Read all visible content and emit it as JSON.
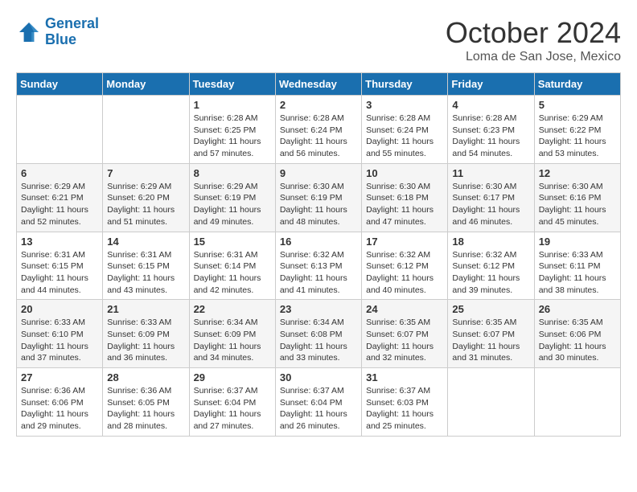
{
  "logo": {
    "line1": "General",
    "line2": "Blue"
  },
  "title": "October 2024",
  "location": "Loma de San Jose, Mexico",
  "weekdays": [
    "Sunday",
    "Monday",
    "Tuesday",
    "Wednesday",
    "Thursday",
    "Friday",
    "Saturday"
  ],
  "weeks": [
    [
      {
        "day": "",
        "info": ""
      },
      {
        "day": "",
        "info": ""
      },
      {
        "day": "1",
        "info": "Sunrise: 6:28 AM\nSunset: 6:25 PM\nDaylight: 11 hours and 57 minutes."
      },
      {
        "day": "2",
        "info": "Sunrise: 6:28 AM\nSunset: 6:24 PM\nDaylight: 11 hours and 56 minutes."
      },
      {
        "day": "3",
        "info": "Sunrise: 6:28 AM\nSunset: 6:24 PM\nDaylight: 11 hours and 55 minutes."
      },
      {
        "day": "4",
        "info": "Sunrise: 6:28 AM\nSunset: 6:23 PM\nDaylight: 11 hours and 54 minutes."
      },
      {
        "day": "5",
        "info": "Sunrise: 6:29 AM\nSunset: 6:22 PM\nDaylight: 11 hours and 53 minutes."
      }
    ],
    [
      {
        "day": "6",
        "info": "Sunrise: 6:29 AM\nSunset: 6:21 PM\nDaylight: 11 hours and 52 minutes."
      },
      {
        "day": "7",
        "info": "Sunrise: 6:29 AM\nSunset: 6:20 PM\nDaylight: 11 hours and 51 minutes."
      },
      {
        "day": "8",
        "info": "Sunrise: 6:29 AM\nSunset: 6:19 PM\nDaylight: 11 hours and 49 minutes."
      },
      {
        "day": "9",
        "info": "Sunrise: 6:30 AM\nSunset: 6:19 PM\nDaylight: 11 hours and 48 minutes."
      },
      {
        "day": "10",
        "info": "Sunrise: 6:30 AM\nSunset: 6:18 PM\nDaylight: 11 hours and 47 minutes."
      },
      {
        "day": "11",
        "info": "Sunrise: 6:30 AM\nSunset: 6:17 PM\nDaylight: 11 hours and 46 minutes."
      },
      {
        "day": "12",
        "info": "Sunrise: 6:30 AM\nSunset: 6:16 PM\nDaylight: 11 hours and 45 minutes."
      }
    ],
    [
      {
        "day": "13",
        "info": "Sunrise: 6:31 AM\nSunset: 6:15 PM\nDaylight: 11 hours and 44 minutes."
      },
      {
        "day": "14",
        "info": "Sunrise: 6:31 AM\nSunset: 6:15 PM\nDaylight: 11 hours and 43 minutes."
      },
      {
        "day": "15",
        "info": "Sunrise: 6:31 AM\nSunset: 6:14 PM\nDaylight: 11 hours and 42 minutes."
      },
      {
        "day": "16",
        "info": "Sunrise: 6:32 AM\nSunset: 6:13 PM\nDaylight: 11 hours and 41 minutes."
      },
      {
        "day": "17",
        "info": "Sunrise: 6:32 AM\nSunset: 6:12 PM\nDaylight: 11 hours and 40 minutes."
      },
      {
        "day": "18",
        "info": "Sunrise: 6:32 AM\nSunset: 6:12 PM\nDaylight: 11 hours and 39 minutes."
      },
      {
        "day": "19",
        "info": "Sunrise: 6:33 AM\nSunset: 6:11 PM\nDaylight: 11 hours and 38 minutes."
      }
    ],
    [
      {
        "day": "20",
        "info": "Sunrise: 6:33 AM\nSunset: 6:10 PM\nDaylight: 11 hours and 37 minutes."
      },
      {
        "day": "21",
        "info": "Sunrise: 6:33 AM\nSunset: 6:09 PM\nDaylight: 11 hours and 36 minutes."
      },
      {
        "day": "22",
        "info": "Sunrise: 6:34 AM\nSunset: 6:09 PM\nDaylight: 11 hours and 34 minutes."
      },
      {
        "day": "23",
        "info": "Sunrise: 6:34 AM\nSunset: 6:08 PM\nDaylight: 11 hours and 33 minutes."
      },
      {
        "day": "24",
        "info": "Sunrise: 6:35 AM\nSunset: 6:07 PM\nDaylight: 11 hours and 32 minutes."
      },
      {
        "day": "25",
        "info": "Sunrise: 6:35 AM\nSunset: 6:07 PM\nDaylight: 11 hours and 31 minutes."
      },
      {
        "day": "26",
        "info": "Sunrise: 6:35 AM\nSunset: 6:06 PM\nDaylight: 11 hours and 30 minutes."
      }
    ],
    [
      {
        "day": "27",
        "info": "Sunrise: 6:36 AM\nSunset: 6:06 PM\nDaylight: 11 hours and 29 minutes."
      },
      {
        "day": "28",
        "info": "Sunrise: 6:36 AM\nSunset: 6:05 PM\nDaylight: 11 hours and 28 minutes."
      },
      {
        "day": "29",
        "info": "Sunrise: 6:37 AM\nSunset: 6:04 PM\nDaylight: 11 hours and 27 minutes."
      },
      {
        "day": "30",
        "info": "Sunrise: 6:37 AM\nSunset: 6:04 PM\nDaylight: 11 hours and 26 minutes."
      },
      {
        "day": "31",
        "info": "Sunrise: 6:37 AM\nSunset: 6:03 PM\nDaylight: 11 hours and 25 minutes."
      },
      {
        "day": "",
        "info": ""
      },
      {
        "day": "",
        "info": ""
      }
    ]
  ]
}
